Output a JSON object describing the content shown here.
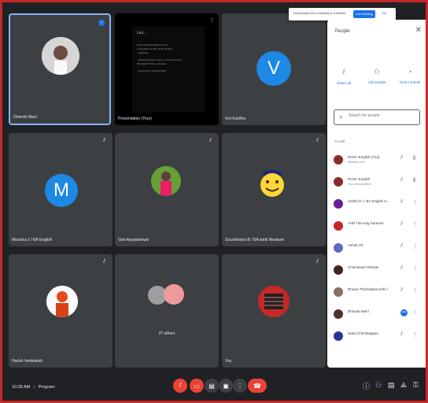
{
  "toast": {
    "text": "Host people into a meeting in a window",
    "button": "Use meeting",
    "dismiss": "Not"
  },
  "tiles": [
    {
      "name": "Dhanda Mani",
      "avatar": "photo"
    },
    {
      "name": "Presentation (Your)",
      "slide_title": "Les...",
      "slide_lines": [
        "Learn the basic effects for the",
        "composites for later Hindi, English",
        "- Literature",
        "- Writing dramas, books or text (feature) for",
        "  (B) English Tense, Literature",
        "- Grammar for English/Tamil"
      ]
    },
    {
      "name": "Vivi Kavitha",
      "letter": "V",
      "color": "#1e88e5"
    },
    {
      "name": "Mounica 2 / BA English",
      "letter": "M",
      "color": "#1e88e5"
    },
    {
      "name": "Vani Ayyasamiyar",
      "avatar": "photo"
    },
    {
      "name": "Soundharya B / BA tamil literature",
      "avatar": "emoji"
    },
    {
      "name": "Harish Venkatesh",
      "avatar": "photo"
    },
    {
      "name": "",
      "center_text": "27 others",
      "avatar": "group"
    },
    {
      "name": "You",
      "avatar": "photo"
    }
  ],
  "panel": {
    "title": "People",
    "actions": [
      {
        "label": "Share all",
        "icon": "share-icon"
      },
      {
        "label": "Add people",
        "icon": "add-person-icon"
      },
      {
        "label": "Host controls",
        "icon": "shield-icon"
      }
    ],
    "search_placeholder": "Search for people",
    "in_call_label": "In call",
    "people": [
      {
        "name": "RASC English (You)",
        "sub": "Meeting host",
        "color": "#8d2b2b"
      },
      {
        "name": "RASC English",
        "sub": "Your presentation",
        "color": "#8d2b2b"
      },
      {
        "name": "Anitha D.I / BA English K...",
        "sub": "",
        "color": "#6a1b9a"
      },
      {
        "name": "Arthi f BA eng Saravan",
        "sub": "",
        "color": "#c62828"
      },
      {
        "name": "Ashok VK",
        "sub": "",
        "color": "#5c6bc0"
      },
      {
        "name": "Chinnasami Raman",
        "sub": "",
        "color": "#3e2723"
      },
      {
        "name": "Dhivya Thezhalamoorthi l",
        "sub": "",
        "color": "#8d6e63"
      },
      {
        "name": "Dhanda Mani",
        "sub": "",
        "color": "#4e342e"
      },
      {
        "name": "Nand Chembappan",
        "sub": "",
        "color": "#283593"
      }
    ]
  },
  "bottom": {
    "time": "10:36 AM",
    "meeting": "Program"
  }
}
